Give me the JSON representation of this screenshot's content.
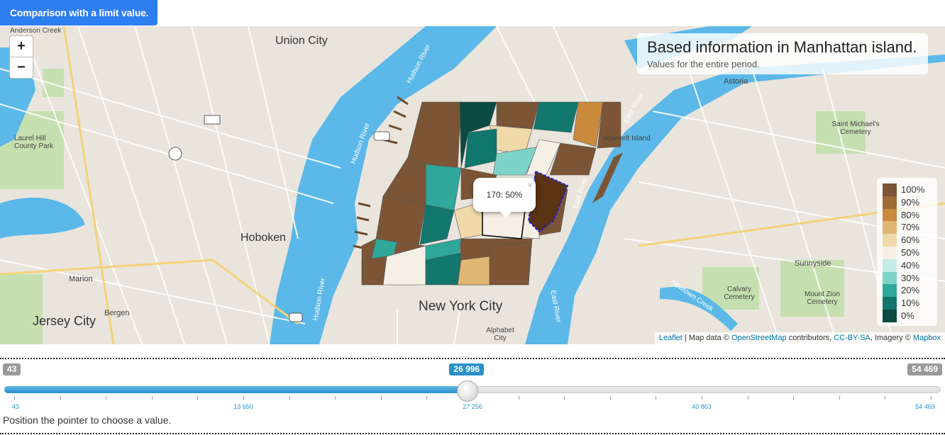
{
  "toolbar": {
    "mode_label": "Comparison with a limit value."
  },
  "map": {
    "zoom_in": "+",
    "zoom_out": "−",
    "info": {
      "title": "Based information in Manhattan island.",
      "subtitle": "Values for the entire period."
    },
    "popup": {
      "text": "170: 50%",
      "close": "×"
    },
    "places": {
      "union_city": "Union City",
      "hoboken": "Hoboken",
      "jersey_city": "Jersey City",
      "new_york_city": "New York City",
      "astoria": "Astoria",
      "laurel_hill": "Laurel Hill County Park",
      "anderson_creek": "Anderson Creek Marsh",
      "marion": "Marion",
      "bergen": "Bergen",
      "sunnyside": "Sunnyside",
      "calvary": "Calvary Cemetery",
      "mount_zion": "Mount Zion Cemetery",
      "saint_michaels": "Saint Michael's Cemetery",
      "roosevelt": "oosevelt Island",
      "alphabet": "Alphabet City",
      "hudson1": "Hudson River",
      "hudson2": "Hudson River",
      "hudson3": "Hudson River",
      "east1": "East River",
      "east2": "East River",
      "east3": "East River",
      "newtown": "Newtown Creek"
    },
    "legend": [
      {
        "label": "100%",
        "color": "#7b5536"
      },
      {
        "label": "90%",
        "color": "#a06a35"
      },
      {
        "label": "80%",
        "color": "#c98a3d"
      },
      {
        "label": "70%",
        "color": "#dfb672"
      },
      {
        "label": "60%",
        "color": "#f0d9a8"
      },
      {
        "label": "50%",
        "color": "#f5f0e6"
      },
      {
        "label": "40%",
        "color": "#c5ebe6"
      },
      {
        "label": "30%",
        "color": "#7ed3c8"
      },
      {
        "label": "20%",
        "color": "#2fa79a"
      },
      {
        "label": "10%",
        "color": "#11776d"
      },
      {
        "label": "0%",
        "color": "#0b4a42"
      }
    ],
    "attribution": {
      "leaflet": "Leaflet",
      "mid": " | Map data © ",
      "osm": "OpenStreetMap",
      "contrib": " contributors, ",
      "cc": "CC-BY-SA",
      "imagery": ", Imagery © ",
      "mapbox": "Mapbox"
    }
  },
  "slider": {
    "min_badge": "43",
    "current_badge": "26 996",
    "max_badge": "54 469",
    "value_fraction": 0.495,
    "tick_labels": [
      "43",
      "13 650",
      "27 256",
      "40 863",
      "54 469"
    ],
    "hint": "Position the pointer to choose a value."
  },
  "colors": {
    "accent": "#2f7ef0",
    "water": "#5bb8e8",
    "slider_fill": "#2a91cc",
    "badge_grey": "#9a9a9a"
  }
}
